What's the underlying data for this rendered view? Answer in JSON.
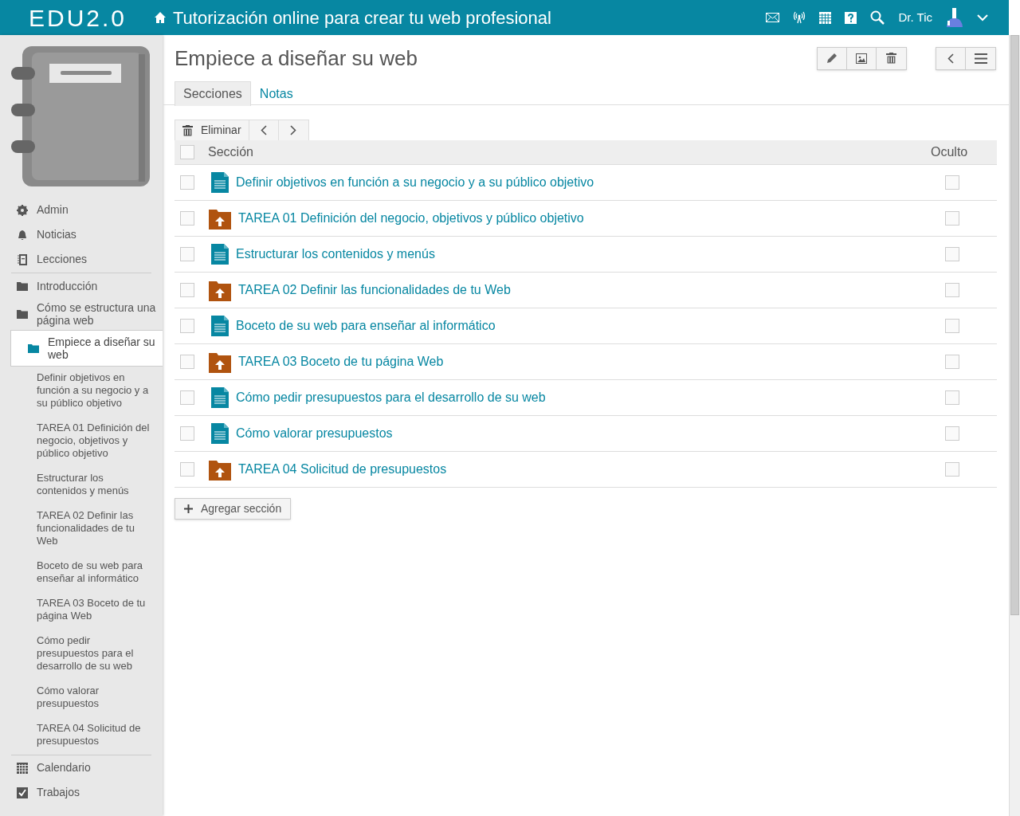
{
  "header": {
    "logo": "EDU2.0",
    "title": "Tutorización online para crear tu web profesional",
    "user": "Dr. Tic"
  },
  "sidebar": {
    "top_items": [
      "Admin",
      "Noticias",
      "Lecciones"
    ],
    "lessons": [
      {
        "label": "Introducción",
        "selected": false
      },
      {
        "label": "Cómo se estructura una página web",
        "selected": false
      },
      {
        "label": "Empiece a diseñar su web",
        "selected": true,
        "children": [
          {
            "label": "Definir objetivos en función a su negocio y a su público objetivo"
          },
          {
            "label": "TAREA 01 Definición del negocio, objetivos y público objetivo"
          },
          {
            "label": "Estructurar los contenidos y menús"
          },
          {
            "label": "TAREA 02 Definir las funcionalidades de tu Web"
          },
          {
            "label": "Boceto de su web para enseñar al informático"
          },
          {
            "label": "TAREA 03 Boceto de tu página Web"
          },
          {
            "label": "Cómo pedir presupuestos para el desarrollo de su web"
          },
          {
            "label": "Cómo valorar presupuestos"
          },
          {
            "label": "TAREA 04 Solicitud de presupuestos"
          }
        ]
      }
    ],
    "bottom_items": [
      "Calendario",
      "Trabajos"
    ]
  },
  "page": {
    "title": "Empiece a diseñar su web",
    "tabs": [
      {
        "label": "Secciones",
        "selected": true
      },
      {
        "label": "Notas",
        "selected": false
      }
    ],
    "toolbar": {
      "delete": "Eliminar"
    },
    "table": {
      "columns": [
        "Sección",
        "Oculto"
      ],
      "all_checked": false,
      "rows": [
        {
          "kind": "page",
          "title": "Definir objetivos en función a su negocio y a su público objetivo",
          "checked": false,
          "hidden": false
        },
        {
          "kind": "task",
          "title": "TAREA 01 Definición del negocio, objetivos y público objetivo",
          "checked": false,
          "hidden": false
        },
        {
          "kind": "page",
          "title": "Estructurar los contenidos y menús",
          "checked": false,
          "hidden": false
        },
        {
          "kind": "task",
          "title": "TAREA 02 Definir las funcionalidades de tu Web",
          "checked": false,
          "hidden": false
        },
        {
          "kind": "page",
          "title": "Boceto de su web para enseñar al informático",
          "checked": false,
          "hidden": false
        },
        {
          "kind": "task",
          "title": "TAREA 03 Boceto de tu página Web",
          "checked": false,
          "hidden": false
        },
        {
          "kind": "page",
          "title": "Cómo pedir presupuestos para el desarrollo de su web",
          "checked": false,
          "hidden": false
        },
        {
          "kind": "page",
          "title": "Cómo valorar presupuestos",
          "checked": false,
          "hidden": false
        },
        {
          "kind": "task",
          "title": "TAREA 04 Solicitud de presupuestos",
          "checked": false,
          "hidden": false
        }
      ]
    },
    "add_button": "Agregar sección"
  }
}
